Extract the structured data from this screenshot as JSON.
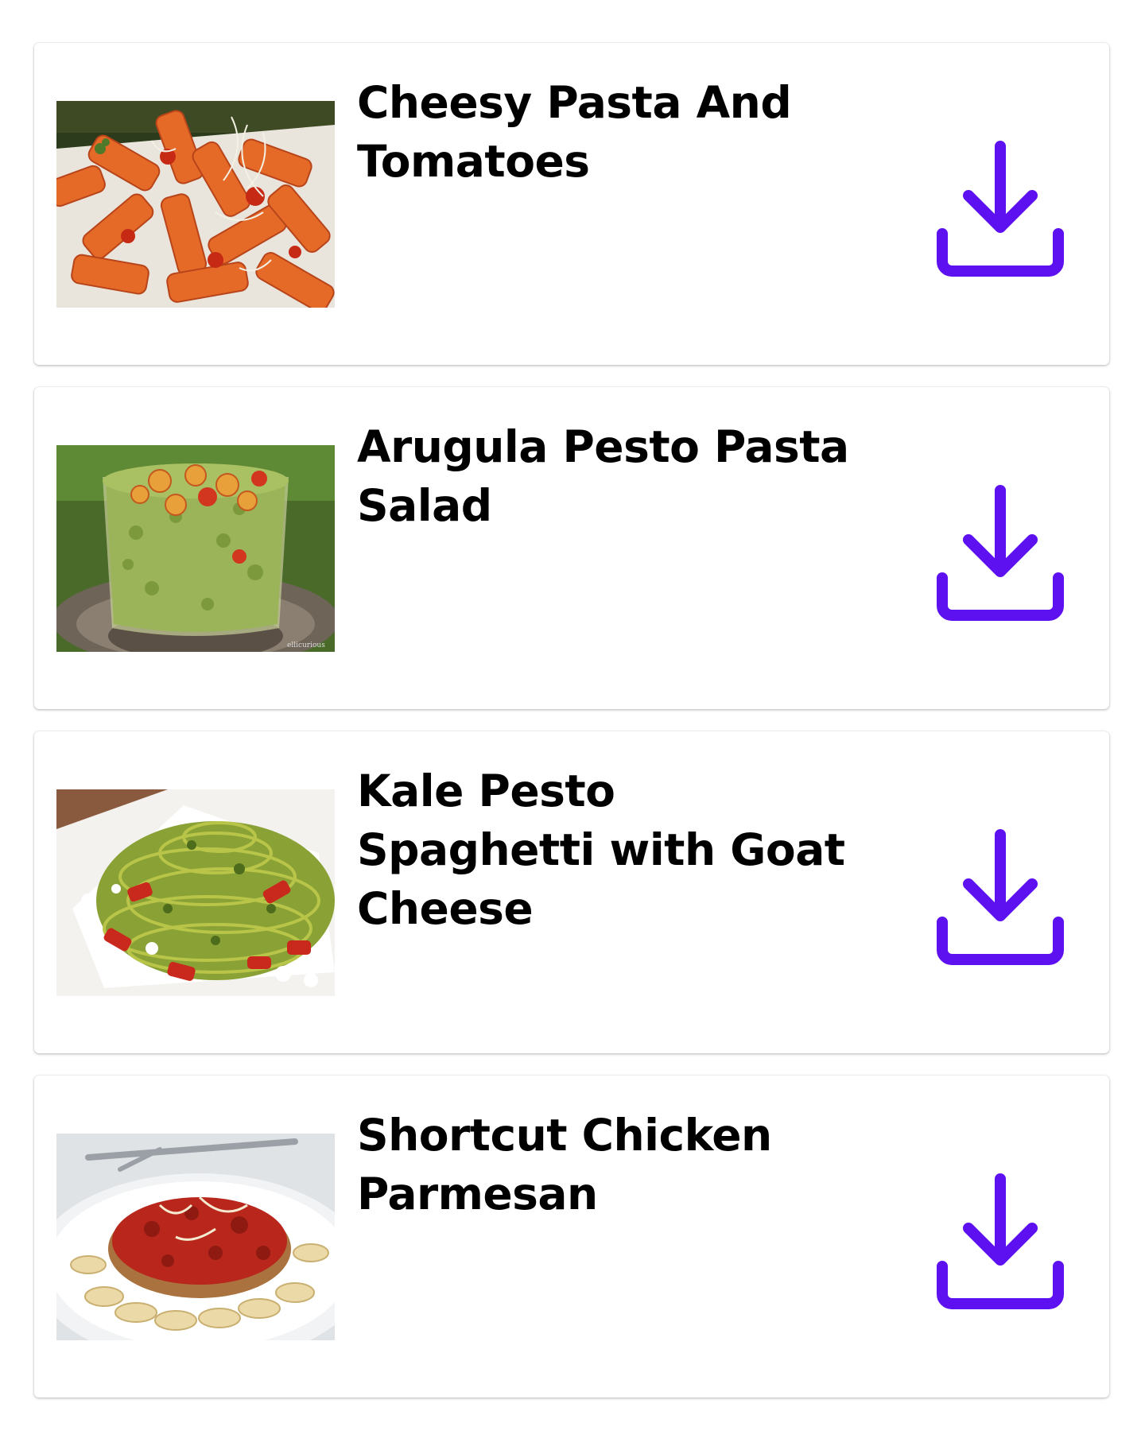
{
  "colors": {
    "accent": "#5d11f0",
    "card_background": "#ffffff",
    "title_text": "#000000"
  },
  "recipes": [
    {
      "title": "Cheesy Pasta And Tomatoes",
      "image": "penne-tomato-photo",
      "action_icon": "download-icon"
    },
    {
      "title": "Arugula Pesto Pasta Salad",
      "image": "pesto-pasta-salad-jar-photo",
      "action_icon": "download-icon"
    },
    {
      "title": "Kale Pesto Spaghetti with Goat Cheese",
      "image": "pesto-spaghetti-photo",
      "action_icon": "download-icon"
    },
    {
      "title": "Shortcut Chicken Parmesan",
      "image": "chicken-parmesan-rotini-photo",
      "action_icon": "download-icon"
    }
  ]
}
